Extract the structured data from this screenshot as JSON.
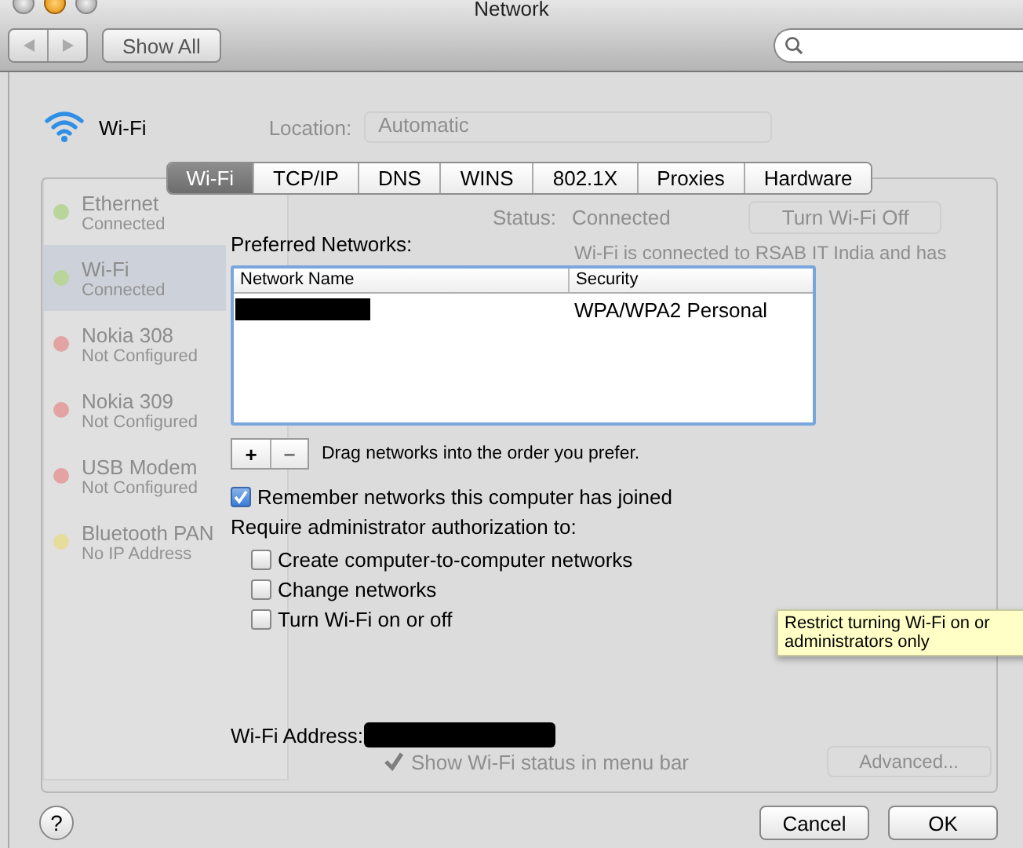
{
  "window": {
    "title": "Network"
  },
  "toolbar": {
    "show_all": "Show All"
  },
  "service": {
    "name": "Wi-Fi"
  },
  "background": {
    "location_label": "Location:",
    "location_value": "Automatic",
    "services": [
      {
        "name": "Ethernet",
        "status": "Connected",
        "color": "#b9d59a",
        "selected": false
      },
      {
        "name": "Wi-Fi",
        "status": "Connected",
        "color": "#b9d59a",
        "selected": true
      },
      {
        "name": "Nokia 308",
        "status": "Not Configured",
        "color": "#e3a3a3",
        "selected": false
      },
      {
        "name": "Nokia 309",
        "status": "Not Configured",
        "color": "#e3a3a3",
        "selected": false
      },
      {
        "name": "USB Modem",
        "status": "Not Configured",
        "color": "#e3a3a3",
        "selected": false
      },
      {
        "name": "Bluetooth PAN",
        "status": "No IP Address",
        "color": "#e6dc9c",
        "selected": false
      }
    ],
    "status_label": "Status:",
    "status_value": "Connected",
    "turn_off_button": "Turn Wi-Fi Off",
    "status_note": "Wi-Fi is connected to RSAB IT India and has",
    "show_status": {
      "label": "Show Wi-Fi status in menu bar",
      "checked": true
    },
    "advanced_button": "Advanced..."
  },
  "sheet": {
    "tabs": [
      {
        "label": "Wi-Fi",
        "selected": true
      },
      {
        "label": "TCP/IP",
        "selected": false
      },
      {
        "label": "DNS",
        "selected": false
      },
      {
        "label": "WINS",
        "selected": false
      },
      {
        "label": "802.1X",
        "selected": false
      },
      {
        "label": "Proxies",
        "selected": false
      },
      {
        "label": "Hardware",
        "selected": false
      }
    ],
    "preferred_label": "Preferred Networks:",
    "table": {
      "columns": [
        "Network Name",
        "Security"
      ],
      "rows": [
        {
          "name_redacted": true,
          "security": "WPA/WPA2 Personal"
        }
      ]
    },
    "add_button": "+",
    "remove_button": "−",
    "drag_hint": "Drag networks into the order you prefer.",
    "remember": {
      "label": "Remember networks this computer has joined",
      "checked": true
    },
    "require_label": "Require administrator authorization to:",
    "options": [
      {
        "label": "Create computer-to-computer networks",
        "checked": false
      },
      {
        "label": "Change networks",
        "checked": false
      },
      {
        "label": "Turn Wi-Fi on or off",
        "checked": false
      }
    ],
    "tooltip": "Restrict turning Wi-Fi on or\nadministrators only",
    "address_label": "Wi-Fi Address:",
    "address_redacted": true
  },
  "buttons": {
    "help": "?",
    "cancel": "Cancel",
    "ok": "OK"
  }
}
